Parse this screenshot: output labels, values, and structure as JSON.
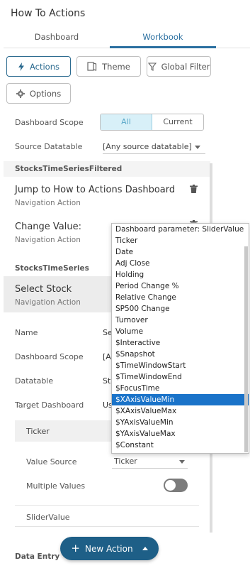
{
  "panel": {
    "title": "How To Actions"
  },
  "tabs": [
    {
      "label": "Dashboard"
    },
    {
      "label": "Workbook"
    }
  ],
  "toolbar": {
    "actions_label": "Actions",
    "theme_label": "Theme",
    "global_filter_label": "Global Filter",
    "options_label": "Options"
  },
  "scope": {
    "label": "Dashboard Scope",
    "options": [
      "All",
      "Current"
    ],
    "selected": "All"
  },
  "source": {
    "label": "Source Datatable",
    "value": "[Any source datatable]"
  },
  "sections": [
    {
      "title": "StocksTimeSeriesFiltered"
    },
    {
      "title": "StocksTimeSeries"
    },
    {
      "title": "Data Entry"
    }
  ],
  "actions": [
    {
      "name": "Jump to How to Actions Dashboard",
      "type": "Navigation Action"
    },
    {
      "name": "Change Value:",
      "type": "Navigation Action"
    },
    {
      "name": "Select Stock",
      "type": "Navigation Action"
    }
  ],
  "details": {
    "name_label": "Name",
    "name_value": "Se",
    "scope_label": "Dashboard Scope",
    "scope_value": "[A",
    "datatable_label": "Datatable",
    "datatable_value": "St",
    "target_label": "Target Dashboard",
    "target_value": "Us"
  },
  "param": {
    "name": "Ticker",
    "value_source_label": "Value Source",
    "value_source": "Ticker",
    "multiple_values_label": "Multiple Values",
    "multiple_values": false,
    "next_param": "SliderValue"
  },
  "new_action_label": "New Action",
  "dropdown": {
    "items": [
      "Dashboard parameter: SliderValue",
      "Ticker",
      "Date",
      "Adj Close",
      "Holding",
      "Period Change %",
      "Relative Change",
      "SP500 Change",
      "Turnover",
      "Volume",
      "$Interactive",
      "$Snapshot",
      "$TimeWindowStart",
      "$TimeWindowEnd",
      "$FocusTime",
      "$XAxisValueMin",
      "$XAxisValueMax",
      "$YAxisValueMin",
      "$YAxisValueMax",
      "$Constant"
    ],
    "highlighted": "$XAxisValueMin"
  },
  "colors": {
    "accent": "#2a6fa0",
    "primary_button": "#1e5f87",
    "highlight": "#1a73c9"
  }
}
